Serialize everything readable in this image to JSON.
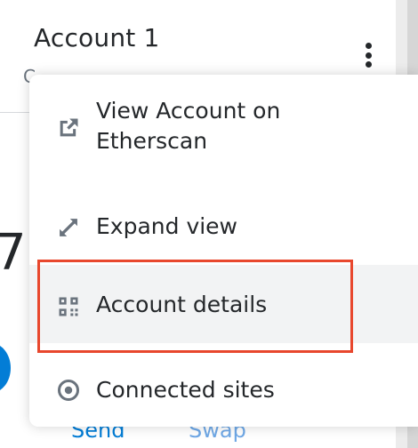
{
  "header": {
    "account_name": "Account 1",
    "address_fragment": "C"
  },
  "background": {
    "balance_fragment": "7",
    "send_label": "Send",
    "swap_label": "Swap"
  },
  "menu": {
    "items": [
      {
        "label": "View Account on Etherscan",
        "icon": "external-link-icon"
      },
      {
        "label": "Expand view",
        "icon": "expand-icon"
      },
      {
        "label": "Account details",
        "icon": "qr-code-icon",
        "highlighted": true
      },
      {
        "label": "Connected sites",
        "icon": "connected-sites-icon"
      }
    ]
  },
  "colors": {
    "text": "#24272a",
    "icon": "#6a737d",
    "highlight_border": "#e8472d",
    "hover_bg": "#f2f3f4",
    "primary_blue": "#037dd6"
  }
}
